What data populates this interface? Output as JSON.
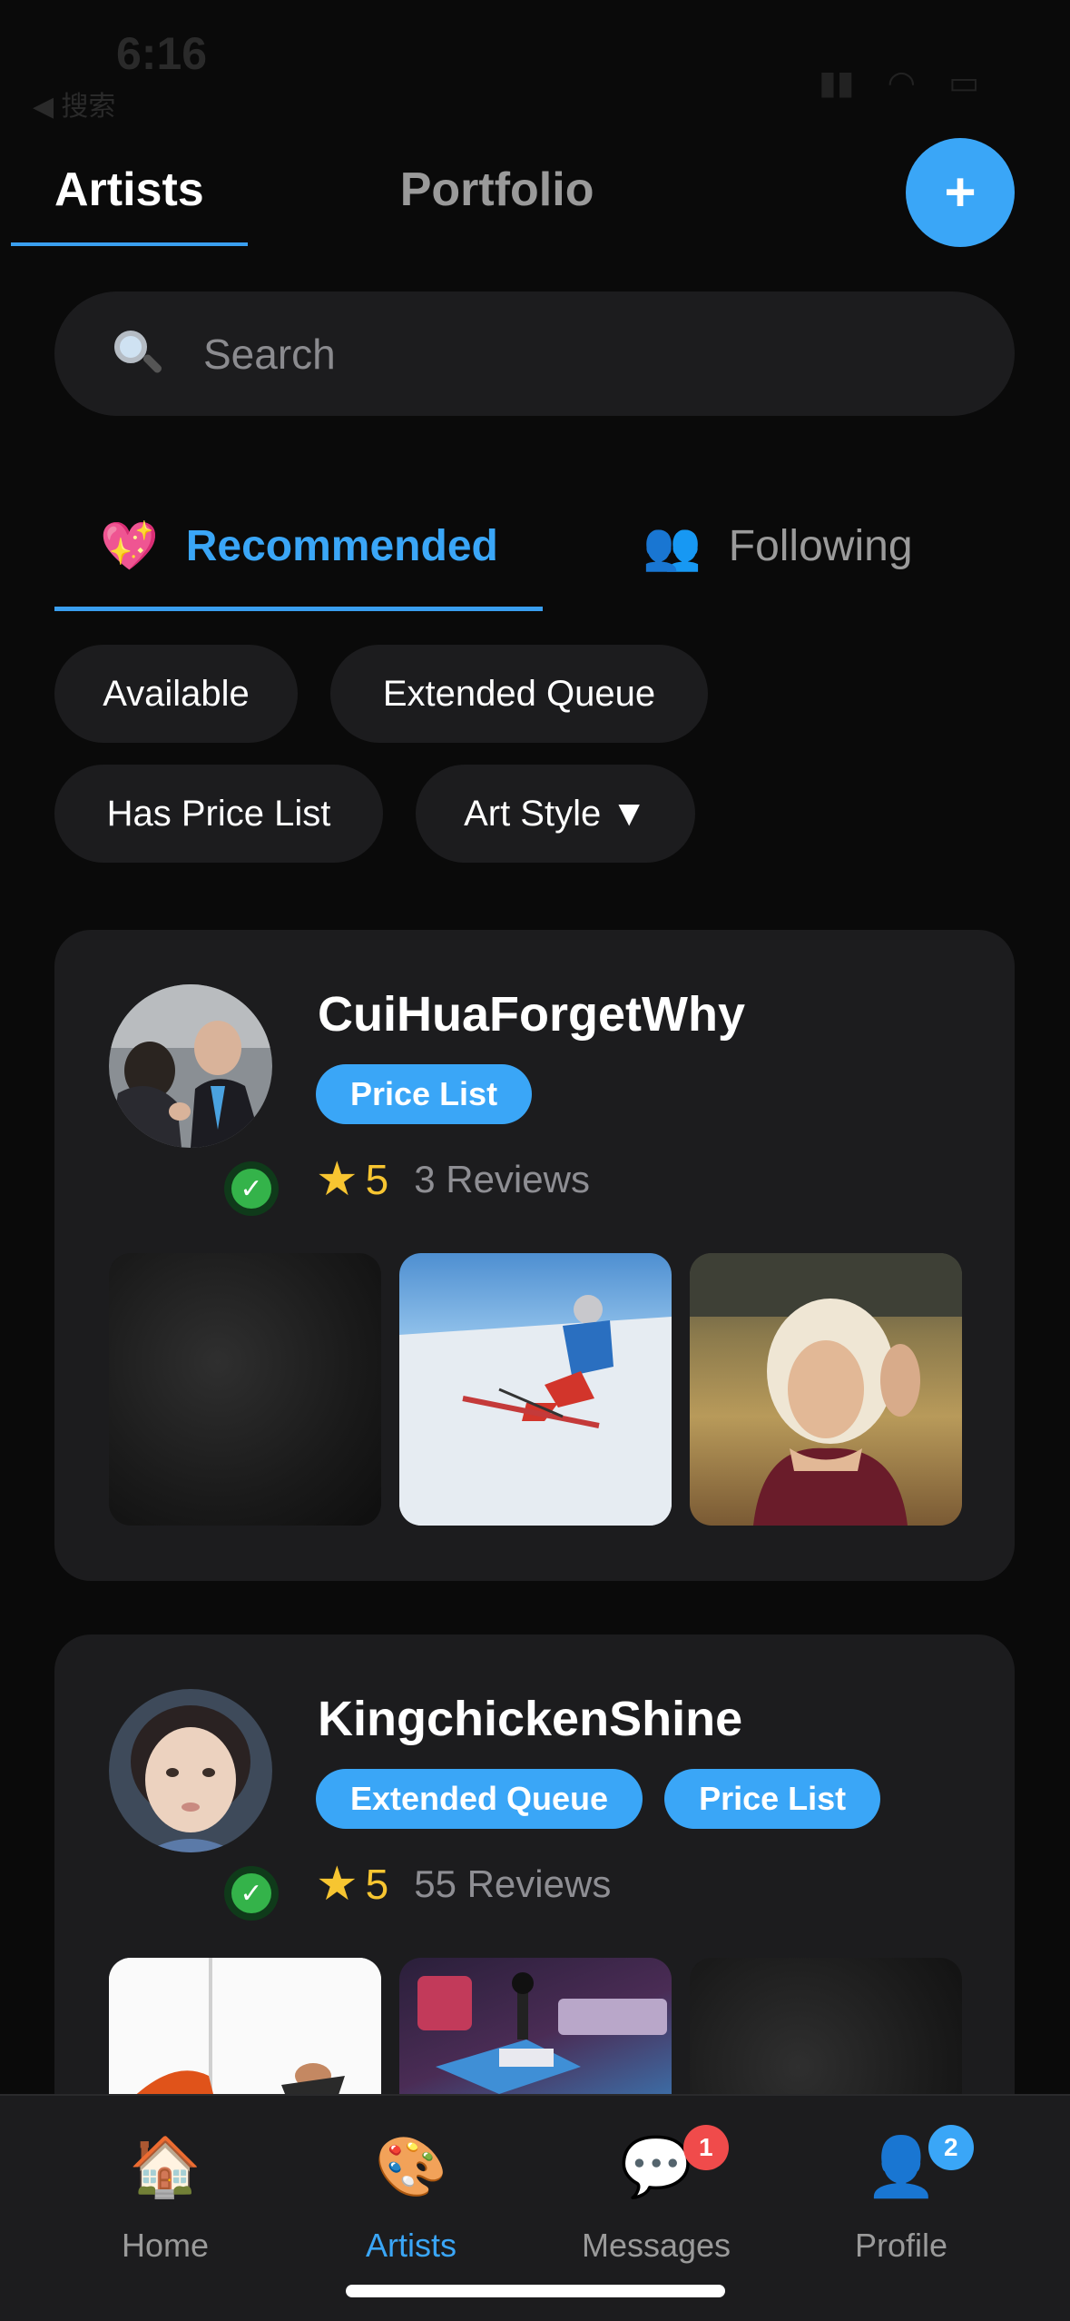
{
  "status_bar": {
    "time": "6:16",
    "back_label": "◀ 搜索"
  },
  "top_tabs": [
    {
      "label": "Artists",
      "active": true
    },
    {
      "label": "Portfolio",
      "active": false
    }
  ],
  "add_button": {
    "label": "+"
  },
  "search": {
    "placeholder": "Search"
  },
  "sub_tabs": [
    {
      "label": "Recommended",
      "icon": "💖",
      "active": true
    },
    {
      "label": "Following",
      "icon": "👥",
      "active": false
    }
  ],
  "filters": [
    "Available",
    "Extended Queue",
    "Has Price List",
    "Art Style ▼"
  ],
  "artists": [
    {
      "name": "CuiHuaForgetWhy",
      "badges": [
        "Price List"
      ],
      "rating": "5",
      "reviews": "3 Reviews",
      "verified": true
    },
    {
      "name": "KingchickenShine",
      "badges": [
        "Extended Queue",
        "Price List"
      ],
      "rating": "5",
      "reviews": "55 Reviews",
      "verified": true
    }
  ],
  "bottom_nav": [
    {
      "label": "Home",
      "icon": "🏠",
      "active": false,
      "badge": ""
    },
    {
      "label": "Artists",
      "icon": "🎨",
      "active": true,
      "badge": ""
    },
    {
      "label": "Messages",
      "icon": "💬",
      "active": false,
      "badge": "1",
      "badge_color": "#f04b4b"
    },
    {
      "label": "Profile",
      "icon": "👤",
      "active": false,
      "badge": "2",
      "badge_color": "#3aa6f7"
    }
  ],
  "colors": {
    "accent": "#3aa6f7",
    "background": "#0a0a0a",
    "surface": "#1c1c1e",
    "star": "#f7c531",
    "verified": "#34b34a"
  }
}
